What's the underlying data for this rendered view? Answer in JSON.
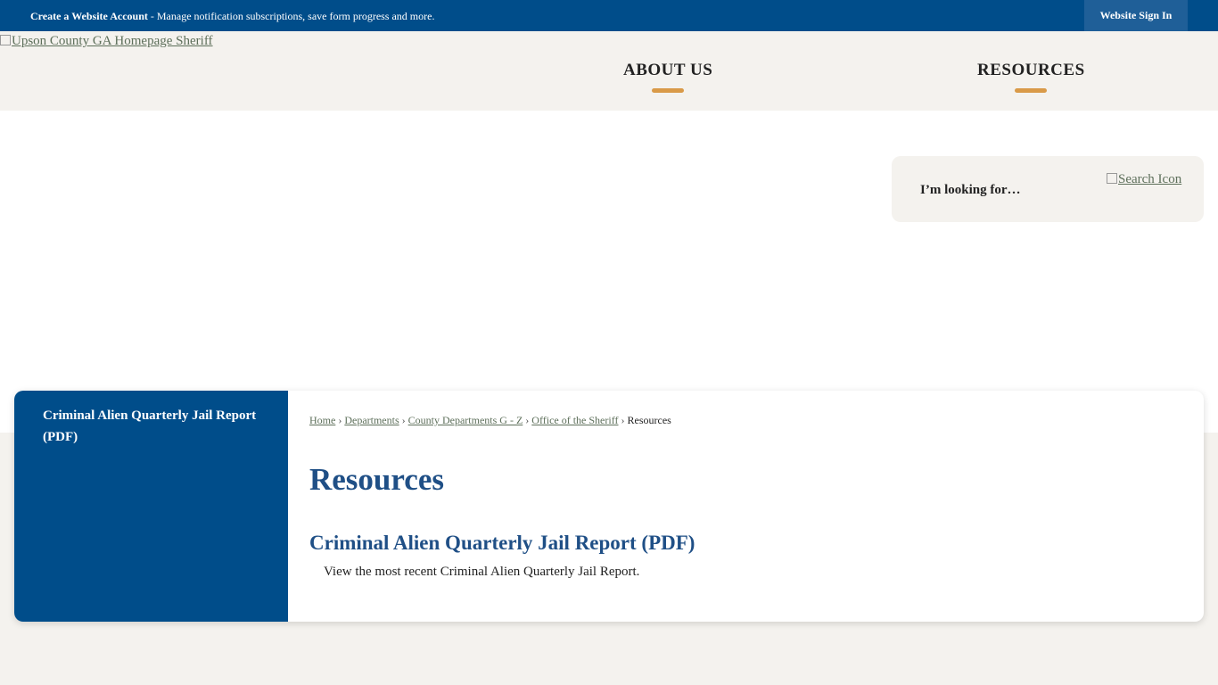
{
  "topbar": {
    "account_label": "Create a Website Account",
    "account_message": " - Manage notification subscriptions, save form progress and more.",
    "signin_label": "Website Sign In"
  },
  "header": {
    "logo_alt": "Upson County GA Homepage Sheriff",
    "nav": [
      {
        "label": "ABOUT US"
      },
      {
        "label": "RESOURCES"
      }
    ]
  },
  "search": {
    "placeholder": "I’m looking for…",
    "icon_alt": "Search Icon"
  },
  "sidebar": {
    "items": [
      {
        "label": "Criminal Alien Quarterly Jail Report (PDF)"
      }
    ]
  },
  "breadcrumb": {
    "items": [
      "Home",
      "Departments",
      "County Departments G - Z",
      "Office of the Sheriff"
    ],
    "current": "Resources",
    "separator": "›"
  },
  "main": {
    "title": "Resources",
    "items": [
      {
        "title": "Criminal Alien Quarterly Jail Report (PDF)",
        "description": "View the most recent Criminal Alien Quarterly Jail Report."
      }
    ]
  },
  "colors": {
    "primary_blue": "#004d8a",
    "heading_blue": "#1f4f86",
    "accent_orange": "#d99a48",
    "background": "#f4f2ee"
  }
}
